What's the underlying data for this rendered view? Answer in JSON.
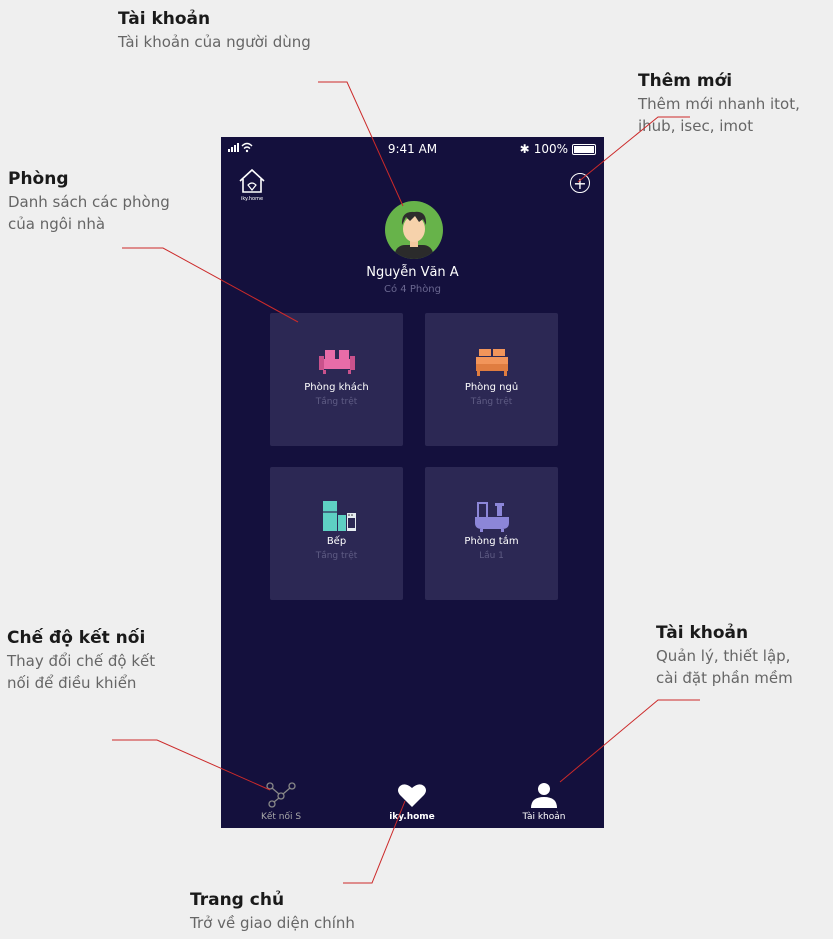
{
  "annotations": {
    "account_top": {
      "title": "Tài khoản",
      "desc": "Tài khoản của người dùng"
    },
    "add_new": {
      "title": "Thêm mới",
      "desc1": "Thêm mới nhanh itot,",
      "desc2": "ihub, isec, imot"
    },
    "rooms": {
      "title": "Phòng",
      "desc1": "Danh sách các phòng",
      "desc2": "của ngôi nhà"
    },
    "connect_mode": {
      "title": "Chế độ kết nối",
      "desc1": "Thay đổi chế độ kết",
      "desc2": "nối để điều khiển"
    },
    "account_bottom": {
      "title": "Tài khoản",
      "desc1": "Quản lý, thiết lập,",
      "desc2": "cài đặt phần mềm"
    },
    "home": {
      "title": "Trang chủ",
      "desc": "Trở về giao diện chính"
    }
  },
  "status": {
    "time": "9:41 AM",
    "battery": "100%",
    "bluetooth": "✱"
  },
  "header": {
    "logo_caption": "iky.home",
    "add_icon": "plus-circle-icon"
  },
  "user": {
    "name": "Nguyễn Văn A",
    "rooms_count": "Có 4 Phòng"
  },
  "rooms": [
    {
      "name": "Phòng khách",
      "floor": "Tầng trệt",
      "icon": "sofa-icon",
      "color": "#e86ca8"
    },
    {
      "name": "Phòng ngủ",
      "floor": "Tầng trệt",
      "icon": "bed-icon",
      "color": "#f2955a"
    },
    {
      "name": "Bếp",
      "floor": "Tầng trệt",
      "icon": "kitchen-icon",
      "color": "#5ed0c3"
    },
    {
      "name": "Phòng tắm",
      "floor": "Lầu 1",
      "icon": "bathtub-icon",
      "color": "#8c86d8"
    }
  ],
  "nav": [
    {
      "label": "Kết nối S",
      "icon": "connection-icon"
    },
    {
      "label": "iky.home",
      "icon": "heart-icon"
    },
    {
      "label": "Tài khoản",
      "icon": "person-icon"
    }
  ],
  "colors": {
    "background": "#14103d",
    "card": "#2c2854",
    "leader_line": "#cc2a2a"
  }
}
